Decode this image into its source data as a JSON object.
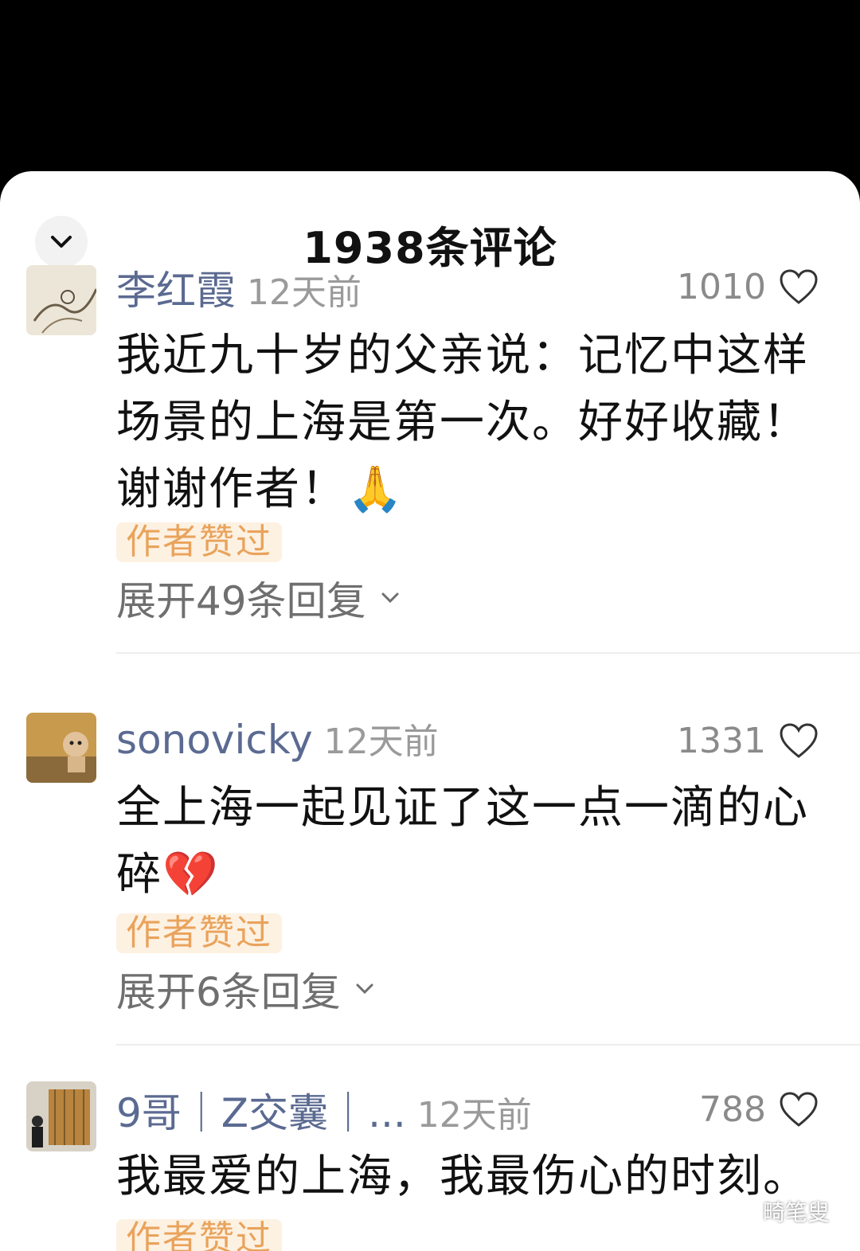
{
  "header": {
    "title": "1938条评论",
    "collapse_icon": "chevron-down-icon"
  },
  "comments": [
    {
      "username": "李红霞",
      "time": "12天前",
      "likes": "1010",
      "text": "我近九十岁的父亲说：记忆中这样场景的上海是第一次。好好收藏！谢谢作者！🙏",
      "badge": "作者赞过",
      "expand": "展开49条回复"
    },
    {
      "username": "sonovicky",
      "time": "12天前",
      "likes": "1331",
      "text": "全上海一起见证了这一点一滴的心碎💔",
      "badge": "作者赞过",
      "expand": "展开6条回复"
    },
    {
      "username": "9哥｜Z交囊｜...",
      "time": "12天前",
      "likes": "788",
      "text": "我最爱的上海，我最伤心的时刻。",
      "badge": "作者赞过"
    }
  ],
  "watermark": {
    "text": "畸笔叟",
    "icon": "wechat-icon"
  },
  "colors": {
    "username": "#5b6a91",
    "badge_text": "#e9a35c",
    "badge_bg": "#fdf1e2"
  }
}
